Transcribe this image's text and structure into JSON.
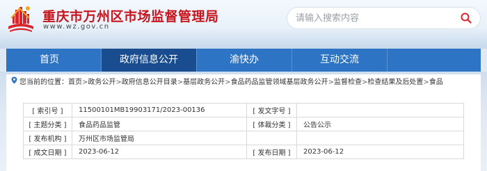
{
  "header": {
    "site_title": "重庆市万州区市场监督管理局",
    "site_url": "www.wz.gov.cn",
    "search": {
      "placeholder": "请输入搜索内容"
    }
  },
  "nav": {
    "items": [
      {
        "label": "首页"
      },
      {
        "label": "政府信息公开"
      },
      {
        "label": "渝快办"
      },
      {
        "label": "互动交流"
      }
    ]
  },
  "breadcrumb": {
    "prefix": "您当前的位置：",
    "items": [
      "首页",
      "政务公开",
      "政府信息公开目录",
      "基层政务公开",
      "食品药品监管领域基层政务公开",
      "监督检查",
      "检查结果及后处置",
      "食品"
    ]
  },
  "info": {
    "index_label": "[ 索引号 ]",
    "index_value": "11500101MB19903171/2023-00136",
    "doc_no_label": "[ 发文字号 ]",
    "doc_no_value": "",
    "topic_label": "[ 主题分类 ]",
    "topic_value": "食品药品监管",
    "genre_label": "[ 体裁分类 ]",
    "genre_value": "公告公示",
    "org_label": "[ 发布机构 ]",
    "org_value": "万州区市场监管局",
    "written_label": "[ 成文日期 ]",
    "written_value": "2023-06-12",
    "pub_label": "[ 发布日期 ]",
    "pub_value": "2023-06-12"
  },
  "colors": {
    "title_red": "#c8141c",
    "nav_blue": "#2e74c4",
    "nav_active": "#1a4d8f"
  }
}
